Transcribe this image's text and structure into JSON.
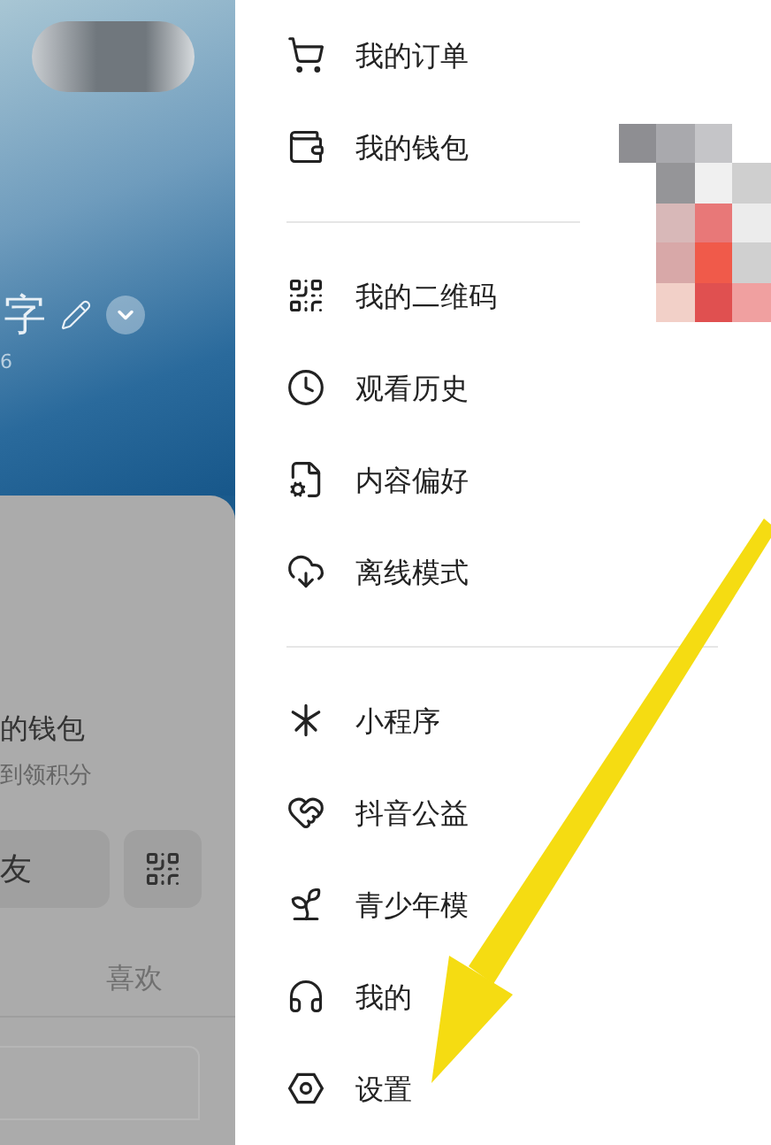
{
  "profile": {
    "name": "字",
    "stat": "6"
  },
  "card": {
    "title": "的钱包",
    "subtitle": "到领积分",
    "friend_button": "友",
    "tab": "喜欢"
  },
  "menu": {
    "groups": [
      {
        "items": [
          {
            "kind": "cart",
            "label": "我的订单"
          },
          {
            "kind": "wallet",
            "label": "我的钱包"
          }
        ]
      },
      {
        "items": [
          {
            "kind": "qr",
            "label": "我的二维码"
          },
          {
            "kind": "clock",
            "label": "观看历史"
          },
          {
            "kind": "doc",
            "label": "内容偏好"
          },
          {
            "kind": "cloud",
            "label": "离线模式"
          }
        ]
      },
      {
        "items": [
          {
            "kind": "mini",
            "label": "小程序"
          },
          {
            "kind": "heart",
            "label": "抖音公益"
          },
          {
            "kind": "sprout",
            "label": "青少年模"
          },
          {
            "kind": "headset",
            "label": "我的"
          },
          {
            "kind": "settings",
            "label": "设置"
          }
        ]
      }
    ]
  }
}
